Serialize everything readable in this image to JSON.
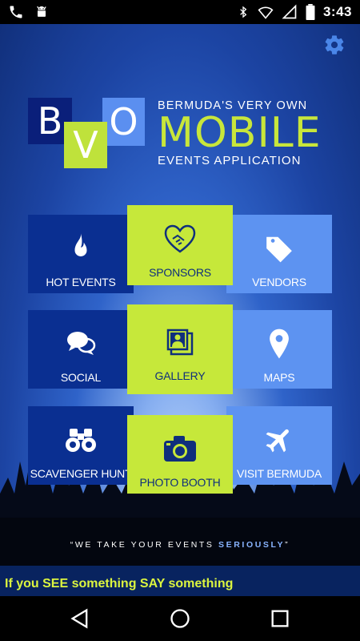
{
  "status_bar": {
    "time": "3:43",
    "icons": [
      "phone-icon",
      "android-icon",
      "bluetooth-icon",
      "wifi-icon",
      "no-signal-icon",
      "battery-icon"
    ]
  },
  "logo": {
    "letters": [
      "B",
      "V",
      "O"
    ],
    "line1": "BERMUDA'S VERY OWN",
    "line2": "MOBILE",
    "line3": "EVENTS APPLICATION"
  },
  "tiles": [
    {
      "label": "HOT EVENTS",
      "icon": "flame-icon"
    },
    {
      "label": "SPONSORS",
      "icon": "handshake-heart-icon"
    },
    {
      "label": "VENDORS",
      "icon": "tag-icon"
    },
    {
      "label": "SOCIAL",
      "icon": "chat-bubbles-icon"
    },
    {
      "label": "GALLERY",
      "icon": "photo-gallery-icon"
    },
    {
      "label": "MAPS",
      "icon": "map-pin-icon"
    },
    {
      "label": "SCAVENGER HUNT",
      "icon": "binoculars-icon"
    },
    {
      "label": "PHOTO BOOTH",
      "icon": "camera-icon"
    },
    {
      "label": "VISIT BERMUDA",
      "icon": "airplane-icon"
    }
  ],
  "tagline": {
    "open_quote": "“",
    "main": "WE TAKE YOUR EVENTS ",
    "emphasis": "SERIOUSLY",
    "close_quote": "”"
  },
  "banner": {
    "text": "If you SEE something SAY something"
  },
  "colors": {
    "dark_tile": "#0a2f91",
    "light_tile": "#5d93f1",
    "accent_lime": "#c6e83a",
    "banner_text": "#dcf53f"
  }
}
